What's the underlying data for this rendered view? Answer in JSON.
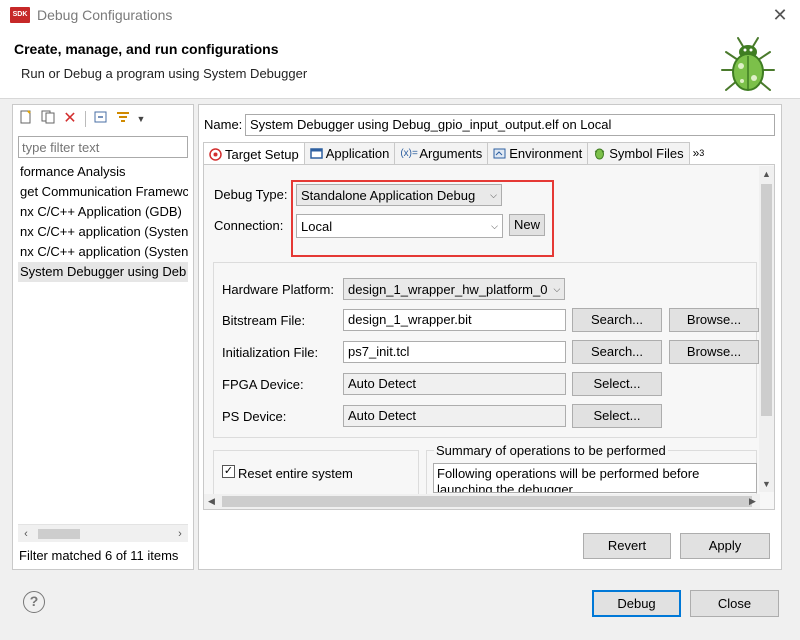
{
  "window": {
    "title": "Debug Configurations",
    "app_icon_text": "SDK"
  },
  "header": {
    "title": "Create, manage, and run configurations",
    "subtitle": "Run or Debug a program using System Debugger"
  },
  "left_panel": {
    "toolbar_icons": [
      "new-config-icon",
      "duplicate-icon",
      "delete-icon",
      "collapse-all-icon",
      "filter-icon",
      "dropdown-arrow-icon"
    ],
    "filter_placeholder": "type filter text",
    "tree_items": [
      "formance Analysis",
      "get Communication Framewc",
      "nx C/C++ Application (GDB)",
      "nx C/C++ application (Systen",
      "nx C/C++ application (Systen",
      "System Debugger using Deb"
    ],
    "selected_index": 5,
    "status": "Filter matched 6 of 11 items"
  },
  "config": {
    "name_label": "Name:",
    "name_value": "System Debugger using Debug_gpio_input_output.elf on Local",
    "tabs": [
      {
        "label": "Target Setup",
        "icon": "target-icon",
        "active": true
      },
      {
        "label": "Application",
        "icon": "application-icon",
        "active": false
      },
      {
        "label": "Arguments",
        "icon": "arguments-icon",
        "active": false
      },
      {
        "label": "Environment",
        "icon": "environment-icon",
        "active": false
      },
      {
        "label": "Symbol Files",
        "icon": "symbol-files-icon",
        "active": false
      }
    ],
    "tabs_overflow": "3",
    "debug_type_label": "Debug Type:",
    "debug_type_value": "Standalone Application Debug",
    "connection_label": "Connection:",
    "connection_value": "Local",
    "new_button": "New",
    "hardware_platform_label": "Hardware Platform:",
    "hardware_platform_value": "design_1_wrapper_hw_platform_0",
    "bitstream_label": "Bitstream File:",
    "bitstream_value": "design_1_wrapper.bit",
    "init_label": "Initialization File:",
    "init_value": "ps7_init.tcl",
    "fpga_label": "FPGA Device:",
    "fpga_value": "Auto Detect",
    "ps_label": "PS Device:",
    "ps_value": "Auto Detect",
    "search_button": "Search...",
    "browse_button": "Browse...",
    "select_button": "Select...",
    "reset_label": "Reset entire system",
    "reset_checked": true,
    "summary_title": "Summary of operations to be performed",
    "summary_text": "Following operations will be performed before launching the debugger."
  },
  "buttons": {
    "revert": "Revert",
    "apply": "Apply",
    "debug": "Debug",
    "close": "Close",
    "help": "?"
  },
  "colors": {
    "highlight_box": "#e53935",
    "default_button_border": "#0078d7",
    "delete_icon": "#d32f2f"
  }
}
